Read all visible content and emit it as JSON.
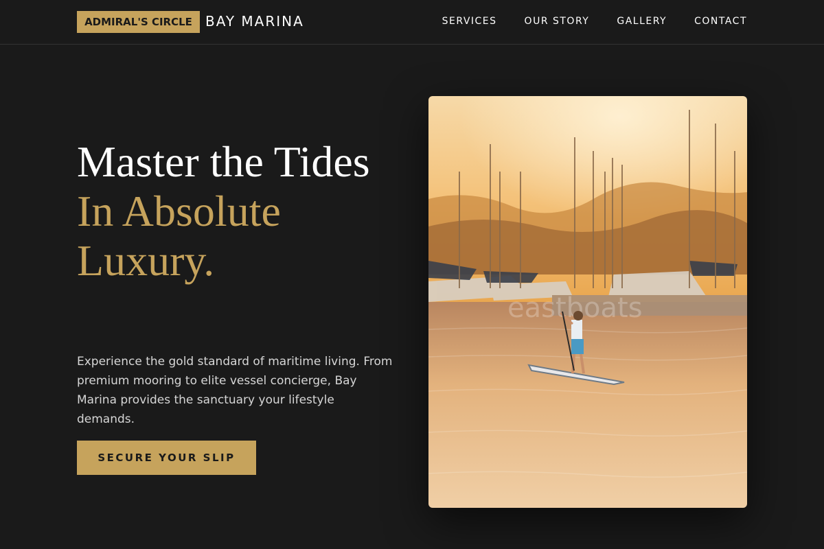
{
  "header": {
    "badge": "ADMIRAL'S CIRCLE",
    "brand": "BAY MARINA",
    "nav": [
      {
        "label": "SERVICES"
      },
      {
        "label": "OUR STORY"
      },
      {
        "label": "GALLERY"
      },
      {
        "label": "CONTACT"
      }
    ]
  },
  "hero": {
    "title_white": "Master the Tides",
    "title_gold": "In Absolute Luxury.",
    "body": "Experience the gold standard of maritime living. From premium mooring to elite vessel concierge, Bay Marina provides the sanctuary your lifestyle demands.",
    "cta": "SECURE YOUR SLIP"
  },
  "photo": {
    "subject": "paddleboarder-marina-sunset",
    "watermark": "eastboats"
  },
  "colors": {
    "background": "#1a1a1a",
    "gold": "#c6a35c",
    "text": "#ffffff",
    "muted": "#d6d6d6"
  }
}
